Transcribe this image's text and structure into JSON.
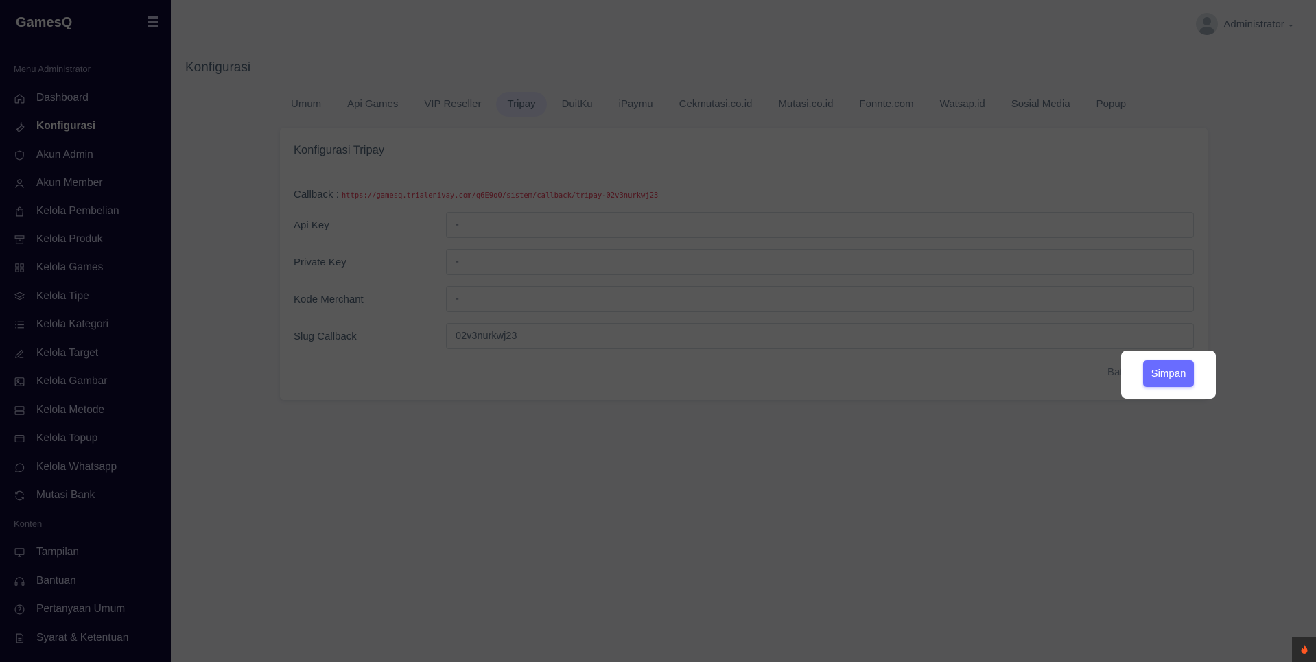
{
  "brand": "GamesQ",
  "user": {
    "name": "Administrator"
  },
  "sidebar": {
    "header_admin": "Menu Administrator",
    "header_content": "Konten",
    "items": [
      {
        "label": "Dashboard",
        "icon": "home-icon"
      },
      {
        "label": "Konfigurasi",
        "icon": "wrench-icon"
      },
      {
        "label": "Akun Admin",
        "icon": "shield-icon"
      },
      {
        "label": "Akun Member",
        "icon": "user-icon"
      },
      {
        "label": "Kelola Pembelian",
        "icon": "shopping-bag-icon"
      },
      {
        "label": "Kelola Produk",
        "icon": "archive-icon"
      },
      {
        "label": "Kelola Games",
        "icon": "grid-icon"
      },
      {
        "label": "Kelola Tipe",
        "icon": "layers-icon"
      },
      {
        "label": "Kelola Kategori",
        "icon": "list-icon"
      },
      {
        "label": "Kelola Target",
        "icon": "pen-icon"
      },
      {
        "label": "Kelola Gambar",
        "icon": "image-icon"
      },
      {
        "label": "Kelola Metode",
        "icon": "server-icon"
      },
      {
        "label": "Kelola Topup",
        "icon": "credit-card-icon"
      },
      {
        "label": "Kelola Whatsapp",
        "icon": "chat-icon"
      },
      {
        "label": "Mutasi Bank",
        "icon": "refresh-icon"
      }
    ],
    "content_items": [
      {
        "label": "Tampilan",
        "icon": "monitor-icon"
      },
      {
        "label": "Bantuan",
        "icon": "headphones-icon"
      },
      {
        "label": "Pertanyaan Umum",
        "icon": "help-circle-icon"
      },
      {
        "label": "Syarat & Ketentuan",
        "icon": "file-text-icon"
      }
    ]
  },
  "page_title": "Konfigurasi",
  "tabs": [
    "Umum",
    "Api Games",
    "VIP Reseller",
    "Tripay",
    "DuitKu",
    "iPaymu",
    "Cekmutasi.co.id",
    "Mutasi.co.id",
    "Fonnte.com",
    "Watsap.id",
    "Sosial Media",
    "Popup"
  ],
  "active_tab": "Tripay",
  "card": {
    "title": "Konfigurasi Tripay",
    "callback_label": "Callback :",
    "callback_url": "https://gamesq.trialenivay.com/q6E9o0/sistem/callback/tripay-02v3nurkwj23",
    "fields": [
      {
        "label": "Api Key",
        "value": "-"
      },
      {
        "label": "Private Key",
        "value": "-"
      },
      {
        "label": "Kode Merchant",
        "value": "-"
      },
      {
        "label": "Slug Callback",
        "value": "02v3nurkwj23"
      }
    ],
    "cancel_label": "Batal",
    "save_label": "Simpan"
  },
  "colors": {
    "sidebar_bg": "#0f0b37",
    "primary": "#696cff",
    "callback": "#e83e5a"
  }
}
